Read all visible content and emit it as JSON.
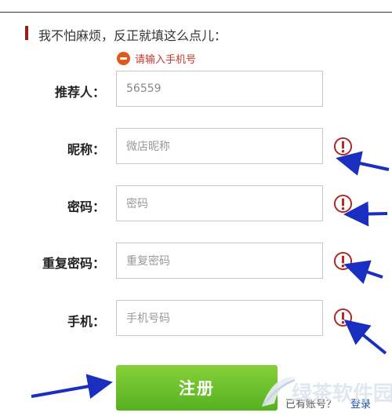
{
  "section": {
    "title": "我不怕麻烦，反正就填这么点儿："
  },
  "error": {
    "message": "请输入手机号"
  },
  "fields": [
    {
      "label": "推荐人：",
      "value": "56559",
      "placeholder": ""
    },
    {
      "label": "昵称：",
      "value": "",
      "placeholder": "微店昵称"
    },
    {
      "label": "密码：",
      "value": "",
      "placeholder": "密码"
    },
    {
      "label": "重复密码：",
      "value": "",
      "placeholder": "重复密码"
    },
    {
      "label": "手机：",
      "value": "",
      "placeholder": "手机号码"
    }
  ],
  "submit": {
    "label": "注册"
  },
  "login": {
    "prompt": "已有账号？",
    "link": "登录"
  },
  "watermark": {
    "text": "绿茶软件园"
  },
  "colors": {
    "accent_green": "#55b120",
    "error_red": "#c0392b",
    "arrow_blue": "#1a2fbf",
    "warn_red": "#b22222"
  },
  "icons": {
    "error": "minus-circle-icon",
    "warning": "exclamation-circle-icon",
    "annotation": "arrow-icon"
  }
}
